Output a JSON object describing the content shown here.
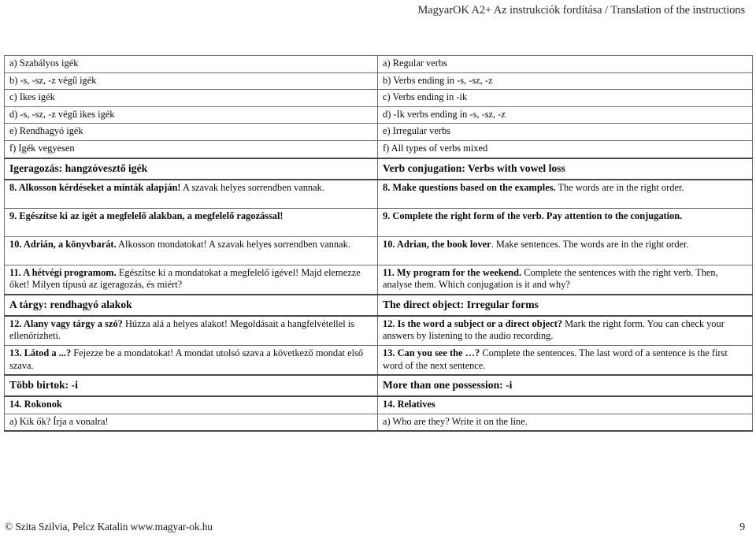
{
  "header": {
    "running_title": "MagyarOK A2+ Az instrukciók fordítása / Translation of the instructions"
  },
  "table": {
    "rows": [
      {
        "type": "item",
        "lines": 1,
        "hu": "a) Szabályos igék",
        "en": "a) Regular verbs"
      },
      {
        "type": "item",
        "lines": 1,
        "hu": "b) -s, -sz, -z végű igék",
        "en": "b) Verbs ending in -s, -sz, -z"
      },
      {
        "type": "item",
        "lines": 1,
        "hu": "c) Ikes igék",
        "en": "c) Verbs ending in -ik"
      },
      {
        "type": "item",
        "lines": 1,
        "hu": "d) -s, -sz, -z végű ikes igék",
        "en": "d) -Ik verbs ending in -s, -sz, -z"
      },
      {
        "type": "item",
        "lines": 1,
        "hu": "e) Rendhagyó igék",
        "en": "e) Irregular verbs"
      },
      {
        "type": "item",
        "lines": 1,
        "hu": "f) Igék vegyesen",
        "en": "f) All types of verbs mixed"
      },
      {
        "type": "section",
        "lines": 1,
        "hu": "Igeragozás: hangzóvesztő igék",
        "en": "Verb conjugation: Verbs with vowel loss"
      },
      {
        "type": "item",
        "lines": 2,
        "hu_lead": "8. Alkosson kérdéseket a minták alapján!",
        "hu_rest": " A szavak helyes sorrendben vannak.",
        "en_lead": "8. Make questions based on the examples.",
        "en_rest": " The words are in the right order."
      },
      {
        "type": "item",
        "lines": 2,
        "hu_lead": "9. Egészítse ki az igét a megfelelő alakban, a megfelelő ragozással!",
        "hu_rest": "",
        "en_lead": "9. Complete the right form of the verb. Pay attention to the conjugation.",
        "en_rest": ""
      },
      {
        "type": "item",
        "lines": 2,
        "hu_lead": "10. Adrián, a könyvbarát.",
        "hu_rest": " Alkosson mondatokat! A szavak helyes sorrendben vannak.",
        "en_lead": "10. Adrian, the book lover",
        "en_rest": ". Make sentences. The words are in the right order."
      },
      {
        "type": "item",
        "lines": 2,
        "hu_lead": "11. A hétvégi programom.",
        "hu_rest": " Egészítse ki a mondatokat a megfelelő igével! Majd elemezze őket! Milyen típusú az igeragozás, és miért?",
        "en_lead": "11. My program for the weekend.",
        "en_rest": " Complete the sentences with the right verb. Then, analyse them. Which conjugation is it and why?"
      },
      {
        "type": "section",
        "lines": 1,
        "hu": "A tárgy: rendhagyó alakok",
        "en": "The direct object: Irregular forms"
      },
      {
        "type": "item",
        "lines": 2,
        "hu_lead": "12. Alany vagy tárgy a szó?",
        "hu_rest": " Húzza alá a helyes alakot! Megoldásait a hangfelvétellel is ellenőrizheti.",
        "en_lead": "12. Is the word a subject or a direct object?",
        "en_rest": " Mark the right form. You can check your answers by listening to the audio recording."
      },
      {
        "type": "item",
        "lines": 2,
        "hu_lead": "13. Látod a ...?",
        "hu_rest": " Fejezze be a mondatokat! A mondat utolsó szava a következő mondat első szava.",
        "en_lead": "13. Can you see the …?",
        "en_rest": " Complete the sentences. The last word of a sentence is the first word of the next sentence."
      },
      {
        "type": "section",
        "lines": 1,
        "hu": "Több birtok: -i",
        "en": "More than one possession: -i",
        "hu_italic_tail": "-i",
        "en_italic_tail": "-i"
      },
      {
        "type": "item",
        "lines": 1,
        "hu": "14. Rokonok",
        "en": "14. Relatives",
        "bold": true
      },
      {
        "type": "item",
        "lines": 1,
        "hu": "a) Kik ők? Írja a vonalra!",
        "en": "a) Who are they? Write it on the line."
      }
    ]
  },
  "footer": {
    "copyright": "© Szita Szilvia, Pelcz Katalin www.magyar-ok.hu",
    "page_number": "9"
  }
}
